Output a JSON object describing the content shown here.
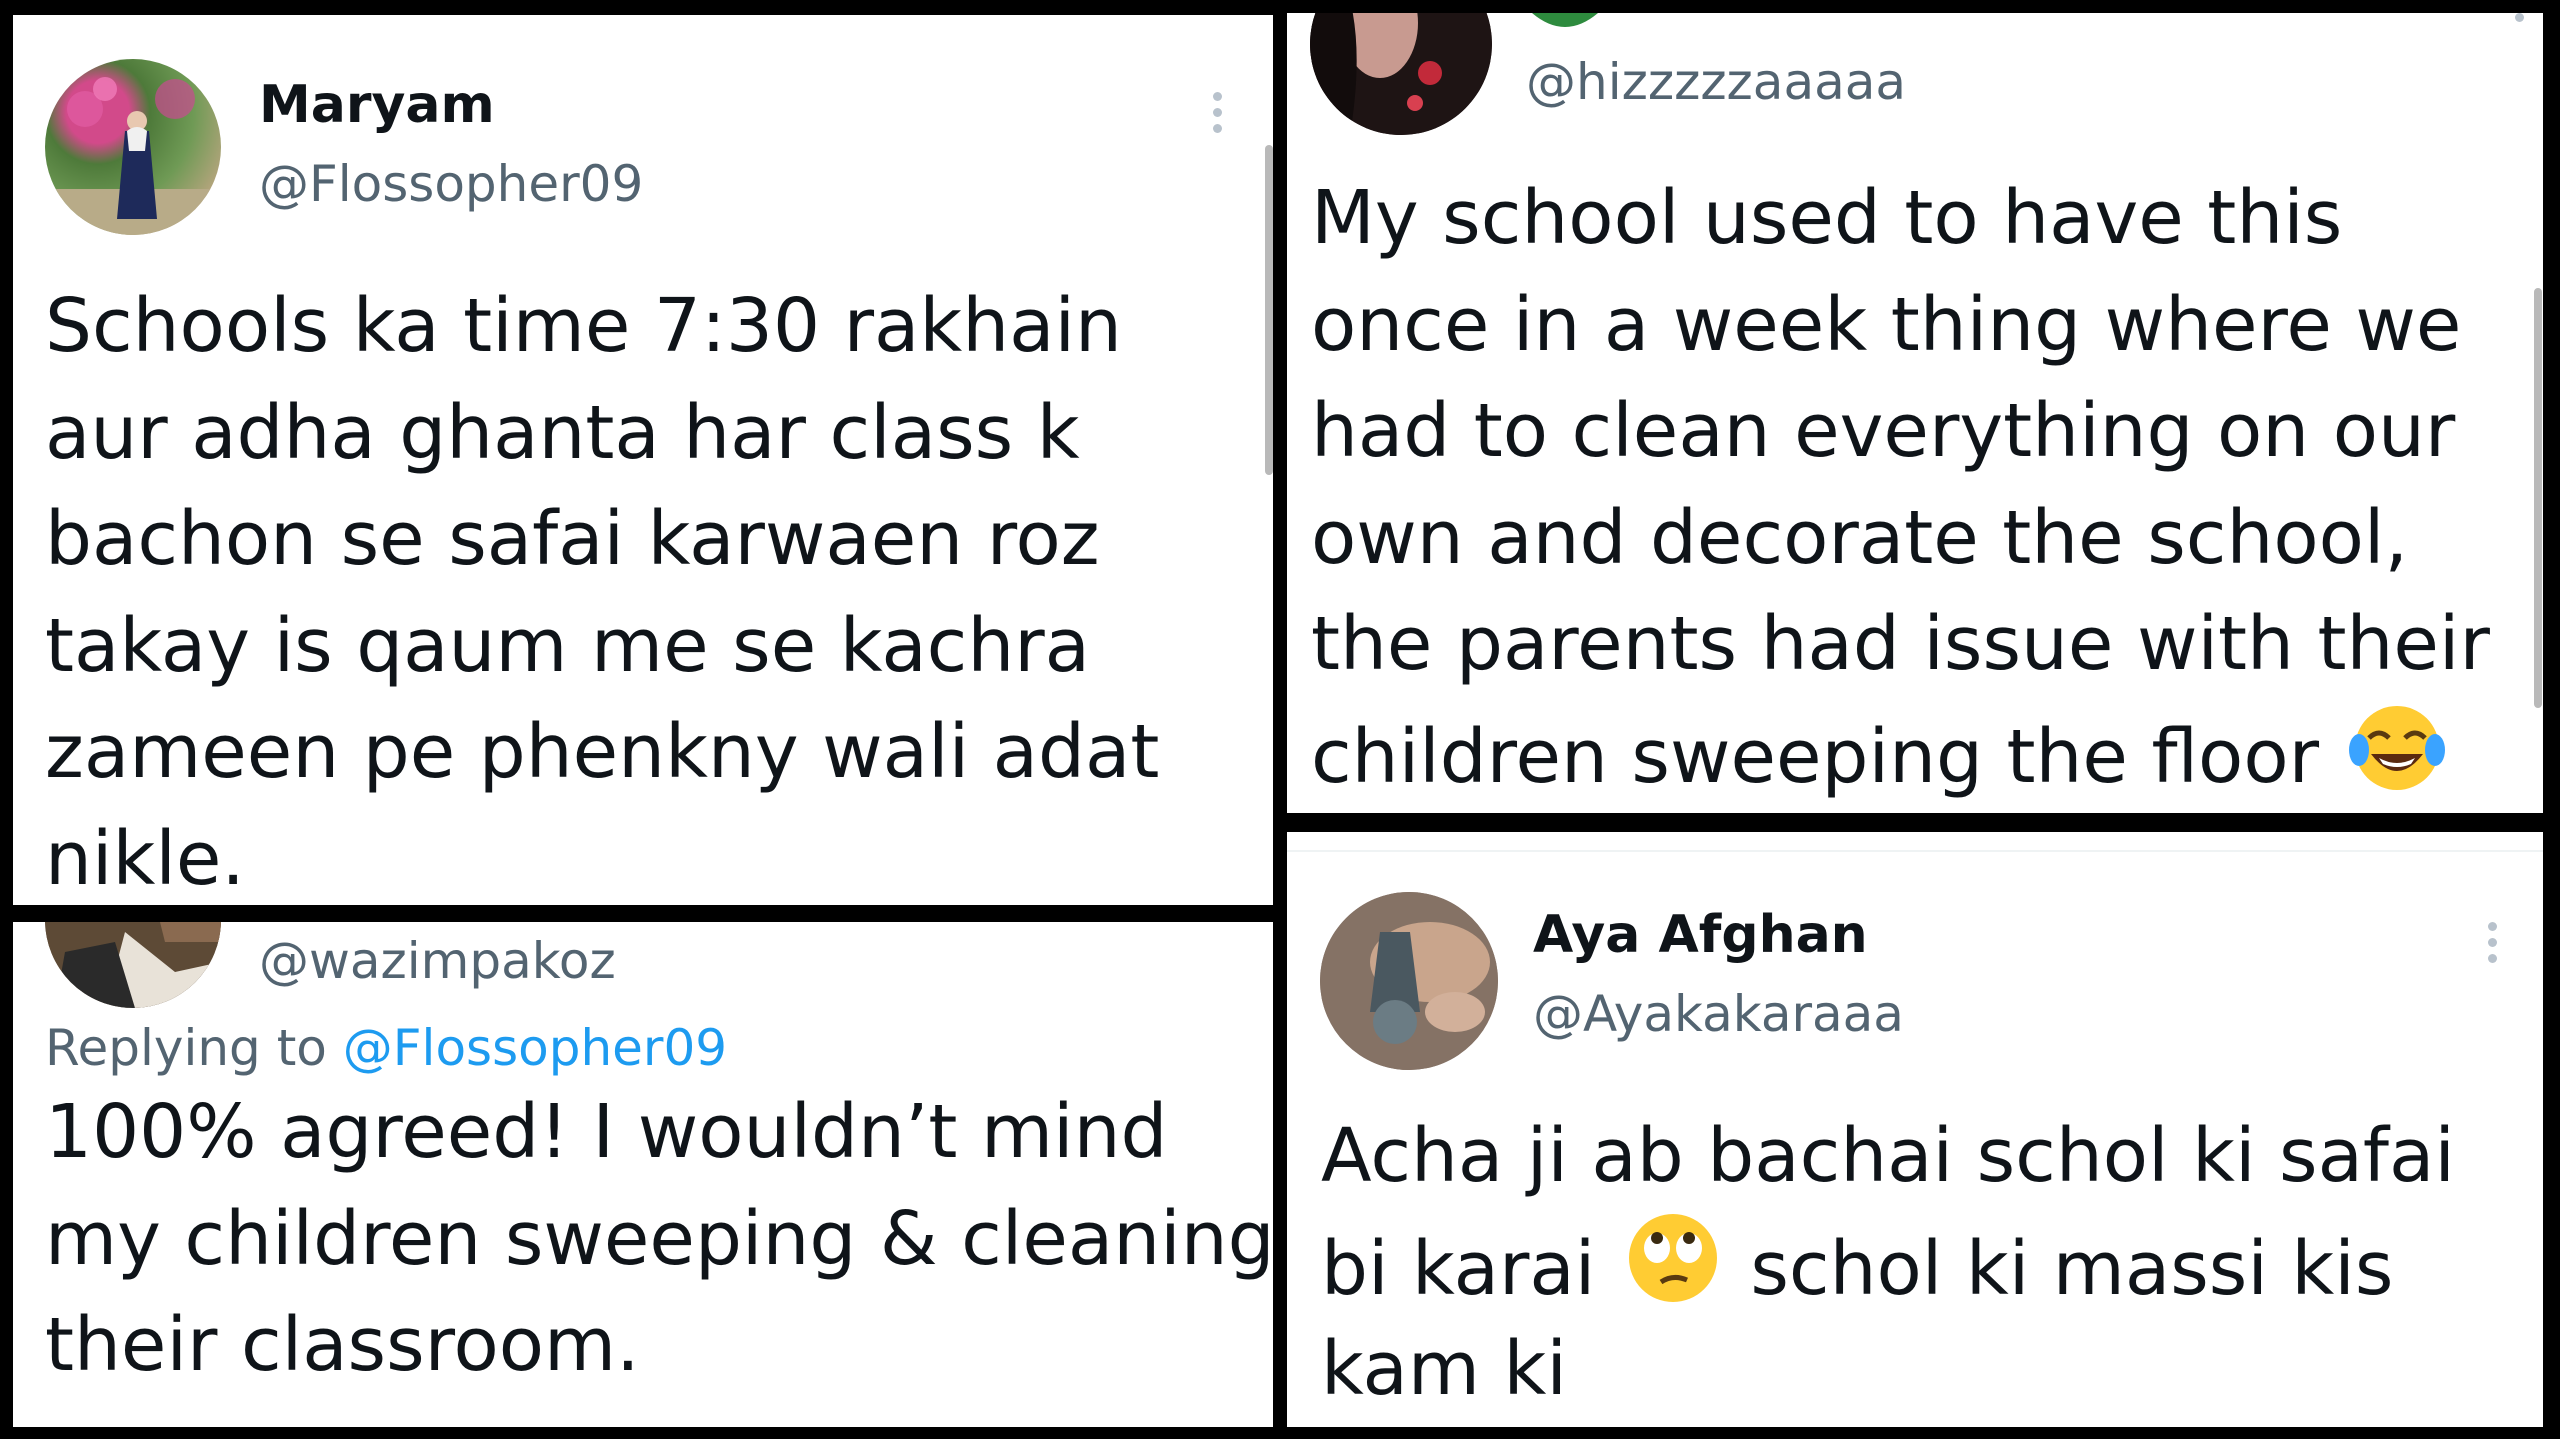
{
  "tweet1": {
    "name": "Maryam",
    "handle": "@Flossopher09",
    "lines": [
      "Schools ka time 7:30 rakhain",
      "aur adha ghanta har class k",
      "bachon se safai karwaen roz",
      "takay is qaum me se kachra",
      "zameen pe phenkny wali adat",
      "nikle."
    ]
  },
  "tweet2": {
    "handle": "@hizzzzzaaaaa",
    "lines": [
      "My school used to have this",
      "once in a week thing where we",
      "had to clean everything on our",
      "own and decorate the school,",
      "the parents had issue with their"
    ],
    "last_line": "children sweeping the floor",
    "emoji": "face-with-tears-of-joy"
  },
  "tweet3": {
    "handle": "@wazimpakoz",
    "replying_prefix": "Replying to",
    "replying_to": "@Flossopher09",
    "lines": [
      "100% agreed! I wouldn’t mind",
      "my children sweeping & cleaning",
      "their classroom."
    ]
  },
  "tweet4": {
    "name": "Aya Afghan",
    "handle": "@Ayakakaraaa",
    "line1": "Acha ji ab bachai schol ki safai",
    "line2_a": "bi karai",
    "line2_b": "schol ki massi kis",
    "line3": "kam ki",
    "emoji": "face-with-rolling-eyes"
  },
  "colors": {
    "text": "#0f1419",
    "secondary": "#536471",
    "link": "#1d9bf0",
    "border": "#000000"
  }
}
